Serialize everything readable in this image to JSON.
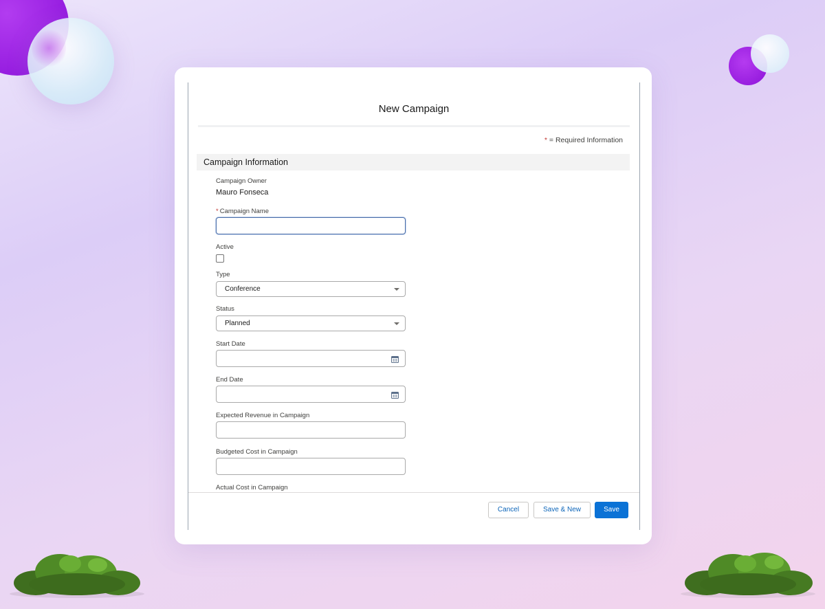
{
  "modal": {
    "title": "New Campaign",
    "required_note_star": "*",
    "required_note": "= Required Information",
    "section_title": "Campaign Information"
  },
  "fields": {
    "owner": {
      "label": "Campaign Owner",
      "value": "Mauro Fonseca"
    },
    "name": {
      "label": "Campaign Name",
      "required_star": "*",
      "value": ""
    },
    "active": {
      "label": "Active",
      "checked": false
    },
    "type": {
      "label": "Type",
      "value": "Conference"
    },
    "status": {
      "label": "Status",
      "value": "Planned"
    },
    "start_date": {
      "label": "Start Date",
      "value": ""
    },
    "end_date": {
      "label": "End Date",
      "value": ""
    },
    "expected_revenue": {
      "label": "Expected Revenue in Campaign",
      "value": ""
    },
    "budgeted_cost": {
      "label": "Budgeted Cost in Campaign",
      "value": ""
    },
    "actual_cost": {
      "label": "Actual Cost in Campaign"
    }
  },
  "footer": {
    "cancel_label": "Cancel",
    "save_new_label": "Save & New",
    "save_label": "Save"
  },
  "icons": {
    "calendar": "calendar-icon",
    "dropdown": "chevron-down-icon"
  },
  "colors": {
    "brand_blue": "#0b72d6",
    "required_red": "#c23934",
    "background_accent": "#8a10d9"
  }
}
